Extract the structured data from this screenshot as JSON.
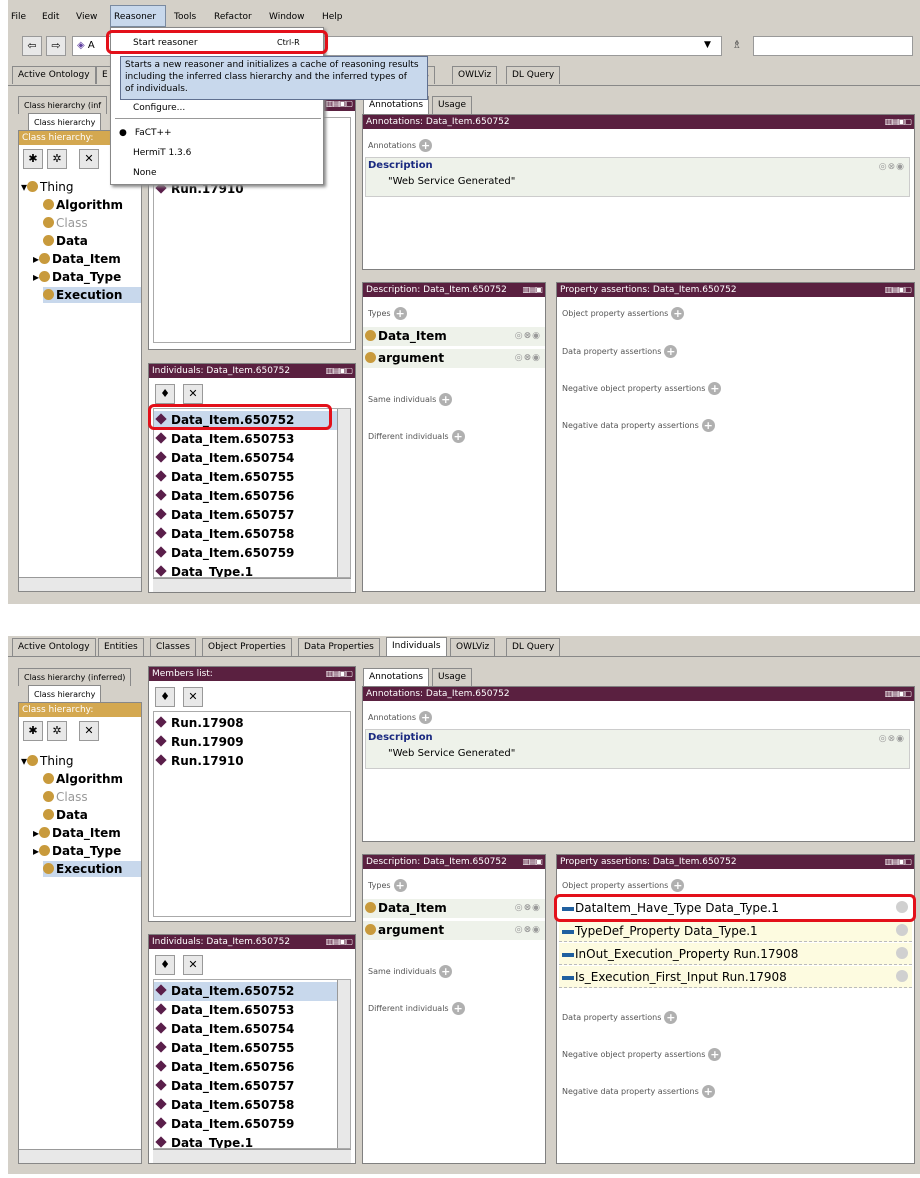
{
  "menu": [
    "File",
    "Edit",
    "View",
    "Reasoner",
    "Tools",
    "Refactor",
    "Window",
    "Help"
  ],
  "reasoner_menu": {
    "start": "Start reasoner",
    "shortcut": "Ctrl-R",
    "tooltip1": "Starts a new reasoner and initializes a cache of reasoning results",
    "tooltip2": "including the inferred class hierarchy and the inferred types of",
    "tooltip3": "of individuals.",
    "configure": "Configure...",
    "fact": "FaCT++",
    "hermit": "HermiT 1.3.6",
    "none": "None"
  },
  "top": {
    "tab_active": "Active Ontology",
    "tab_e": "E",
    "tab_als": "als",
    "tab_owlviz": "OWLViz",
    "tab_dlquery": "DL Query",
    "tab_a": "A"
  },
  "tabs2": [
    "Active Ontology",
    "Entities",
    "Classes",
    "Object Properties",
    "Data Properties",
    "Individuals",
    "OWLViz",
    "DL Query"
  ],
  "class_tabs": {
    "inferred": "Class hierarchy (inferred)",
    "inferred_short": "Class hierarchy (inf",
    "hier": "Class hierarchy",
    "hier_hdr": "Class hierarchy:"
  },
  "tree": {
    "thing": "Thing",
    "algorithm": "Algorithm",
    "class": "Class",
    "data": "Data",
    "data_item": "Data_Item",
    "data_type": "Data_Type",
    "execution": "Execution"
  },
  "members": {
    "title": "Members list:",
    "items": [
      "Run.17908",
      "Run.17909",
      "Run.17910"
    ],
    "top_item": "Run.17910"
  },
  "annot": {
    "tab_a": "Annotations",
    "tab_u": "Usage",
    "header": "Annotations: Data_Item.650752",
    "label": "Annotations",
    "desc": "Description",
    "value": "\"Web Service Generated\""
  },
  "individuals": {
    "header": "Individuals: Data_Item.650752",
    "items": [
      "Data_Item.650752",
      "Data_Item.650753",
      "Data_Item.650754",
      "Data_Item.650755",
      "Data_Item.650756",
      "Data_Item.650757",
      "Data_Item.650758",
      "Data_Item.650759",
      "Data_Type.1"
    ]
  },
  "descr": {
    "header": "Description: Data_Item.650752",
    "types": "Types",
    "t1": "Data_Item",
    "t2": "argument",
    "same": "Same individuals",
    "diff": "Different individuals"
  },
  "props": {
    "header": "Property assertions: Data_Item.650752",
    "obj": "Object property assertions",
    "data": "Data property assertions",
    "negobj": "Negative object property assertions",
    "negdata": "Negative data property assertions",
    "assertions": [
      "DataItem_Have_Type  Data_Type.1",
      "TypeDef_Property  Data_Type.1",
      "InOut_Execution_Property  Run.17908",
      "Is_Execution_First_Input  Run.17908"
    ]
  },
  "colors": {
    "header": "#5a2040",
    "highlight": "#e3101a",
    "selection": "#c8d8ec"
  }
}
